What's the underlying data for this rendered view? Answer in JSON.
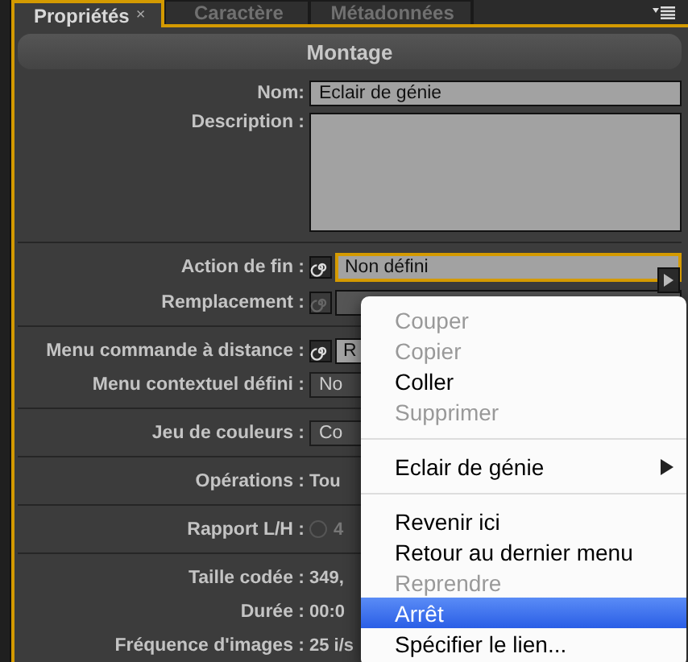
{
  "tabs": [
    {
      "label": "Propriétés",
      "selected": true,
      "close": "×"
    },
    {
      "label": "Caractère",
      "selected": false
    },
    {
      "label": "Métadonnées",
      "selected": false
    }
  ],
  "header": "Montage",
  "sections": [
    {
      "rows": [
        {
          "kind": "field",
          "label": "Nom:",
          "value": "Eclair de génie"
        },
        {
          "kind": "area",
          "label": "Description :"
        }
      ]
    },
    {
      "rows": [
        {
          "kind": "link",
          "label": "Action de fin :",
          "value": "Non défini",
          "disabled": false,
          "focused": true
        },
        {
          "kind": "link",
          "label": "Remplacement :",
          "disabled": true,
          "focused": false
        }
      ]
    },
    {
      "rows": [
        {
          "kind": "link",
          "label": "Menu commande à distance :",
          "value": "R",
          "disabled": false,
          "focused": false
        },
        {
          "kind": "select",
          "label": "Menu contextuel défini :",
          "value": "No"
        }
      ]
    },
    {
      "rows": [
        {
          "kind": "select",
          "label": "Jeu de couleurs :",
          "value": "Co"
        }
      ]
    },
    {
      "rows": [
        {
          "kind": "text",
          "label": "Opérations :",
          "value": "Tou"
        }
      ]
    },
    {
      "rows": [
        {
          "kind": "radio",
          "label": "Rapport L/H :",
          "value": "4",
          "checked": false
        }
      ]
    },
    {
      "rows": [
        {
          "kind": "text",
          "label": "Taille codée :",
          "value": "349,"
        },
        {
          "kind": "text",
          "label": "Durée :",
          "value": "00:0"
        },
        {
          "kind": "text",
          "label": "Fréquence d'images :",
          "value": "25 i/s"
        }
      ]
    }
  ],
  "menu": [
    {
      "kind": "item",
      "label": "Couper",
      "disabled": true,
      "selected": false
    },
    {
      "kind": "item",
      "label": "Copier",
      "disabled": true,
      "selected": false
    },
    {
      "kind": "item",
      "label": "Coller",
      "disabled": false,
      "selected": false
    },
    {
      "kind": "item",
      "label": "Supprimer",
      "disabled": true,
      "selected": false
    },
    {
      "kind": "separator"
    },
    {
      "kind": "submenu",
      "label": "Eclair de génie",
      "disabled": false,
      "selected": false
    },
    {
      "kind": "separator"
    },
    {
      "kind": "item",
      "label": "Revenir ici",
      "disabled": false,
      "selected": false
    },
    {
      "kind": "item",
      "label": "Retour au dernier menu",
      "disabled": false,
      "selected": false
    },
    {
      "kind": "item",
      "label": "Reprendre",
      "disabled": true,
      "selected": false
    },
    {
      "kind": "item",
      "label": "Arrêt",
      "disabled": false,
      "selected": true
    },
    {
      "kind": "item",
      "label": "Spécifier le lien...",
      "disabled": false,
      "selected": false
    }
  ]
}
